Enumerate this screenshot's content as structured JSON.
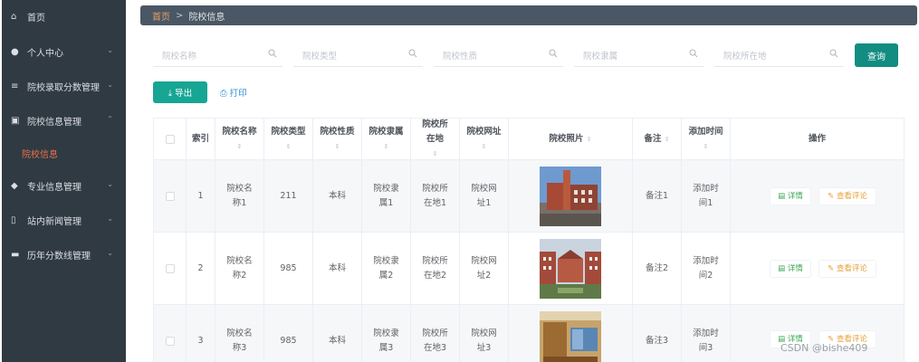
{
  "sidebar": {
    "items": [
      {
        "label": "首页",
        "icon": "home-icon",
        "glyph": "⌂"
      },
      {
        "label": "个人中心",
        "icon": "user-icon",
        "glyph": "●"
      },
      {
        "label": "院校录取分数管理",
        "icon": "list-icon",
        "glyph": "≡"
      },
      {
        "label": "院校信息管理",
        "icon": "clipboard-icon",
        "glyph": "▣"
      },
      {
        "label": "专业信息管理",
        "icon": "pin-icon",
        "glyph": "◆"
      },
      {
        "label": "站内新闻管理",
        "icon": "phone-icon",
        "glyph": "▯"
      },
      {
        "label": "历年分数线管理",
        "icon": "briefcase-icon",
        "glyph": "▬"
      }
    ],
    "active_sub": "院校信息",
    "chevron_down": "⌄",
    "chevron_up": "⌃"
  },
  "breadcrumb": {
    "home": "首页",
    "separator": ">",
    "current": "院校信息"
  },
  "search": {
    "placeholders": [
      "院校名称",
      "院校类型",
      "院校性质",
      "院校隶属",
      "院校所在地"
    ],
    "query_label": "查询"
  },
  "actions": {
    "export_label": "⤓ 导出",
    "print_label": "⎙ 打印"
  },
  "table": {
    "headers": [
      "索引",
      "院校名称",
      "院校类型",
      "院校性质",
      "院校隶属",
      "院校所在地",
      "院校网址",
      "院校照片",
      "备注",
      "添加时间",
      "操作"
    ],
    "sort_glyph": "⇕",
    "rows": [
      {
        "index": "1",
        "name": "院校名称1",
        "type": "211",
        "nature": "本科",
        "affiliation": "院校隶属1",
        "location": "院校所在地1",
        "website": "院校网址1",
        "remark": "备注1",
        "added": "添加时间1"
      },
      {
        "index": "2",
        "name": "院校名称2",
        "type": "985",
        "nature": "本科",
        "affiliation": "院校隶属2",
        "location": "院校所在地2",
        "website": "院校网址2",
        "remark": "备注2",
        "added": "添加时间2"
      },
      {
        "index": "3",
        "name": "院校名称3",
        "type": "985",
        "nature": "本科",
        "affiliation": "院校隶属3",
        "location": "院校所在地3",
        "website": "院校网址3",
        "remark": "备注3",
        "added": "添加时间3"
      }
    ],
    "detail_label": "▤ 详情",
    "review_label": "✎ 查看评论"
  },
  "watermark": "CSDN @bishe409",
  "colors": {
    "sidebar_bg": "#303a43",
    "accent": "#138c82",
    "export": "#17a594",
    "active_sub": "#e8734a"
  }
}
